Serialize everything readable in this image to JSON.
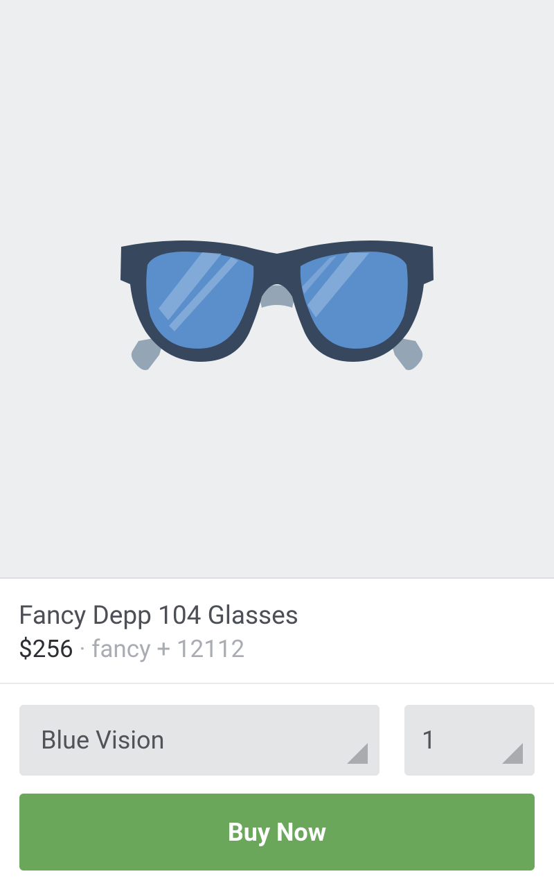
{
  "product": {
    "title": "Fancy Depp 104 Glasses",
    "price": "$256",
    "separator": "·",
    "shop_label": "fancy + 12112"
  },
  "variant_select": {
    "value": "Blue Vision",
    "icon": "dropdown-corner-icon"
  },
  "quantity_select": {
    "value": "1",
    "icon": "dropdown-corner-icon"
  },
  "buy_button": {
    "label": "Buy Now"
  },
  "colors": {
    "hero_bg": "#edeef0",
    "frame": "#37475e",
    "lens": "#5b8fcb",
    "temple": "#94a5b6",
    "buy": "#6aa75b",
    "select_bg": "#e4e5e7"
  },
  "image": {
    "icon": "sunglasses-icon"
  }
}
